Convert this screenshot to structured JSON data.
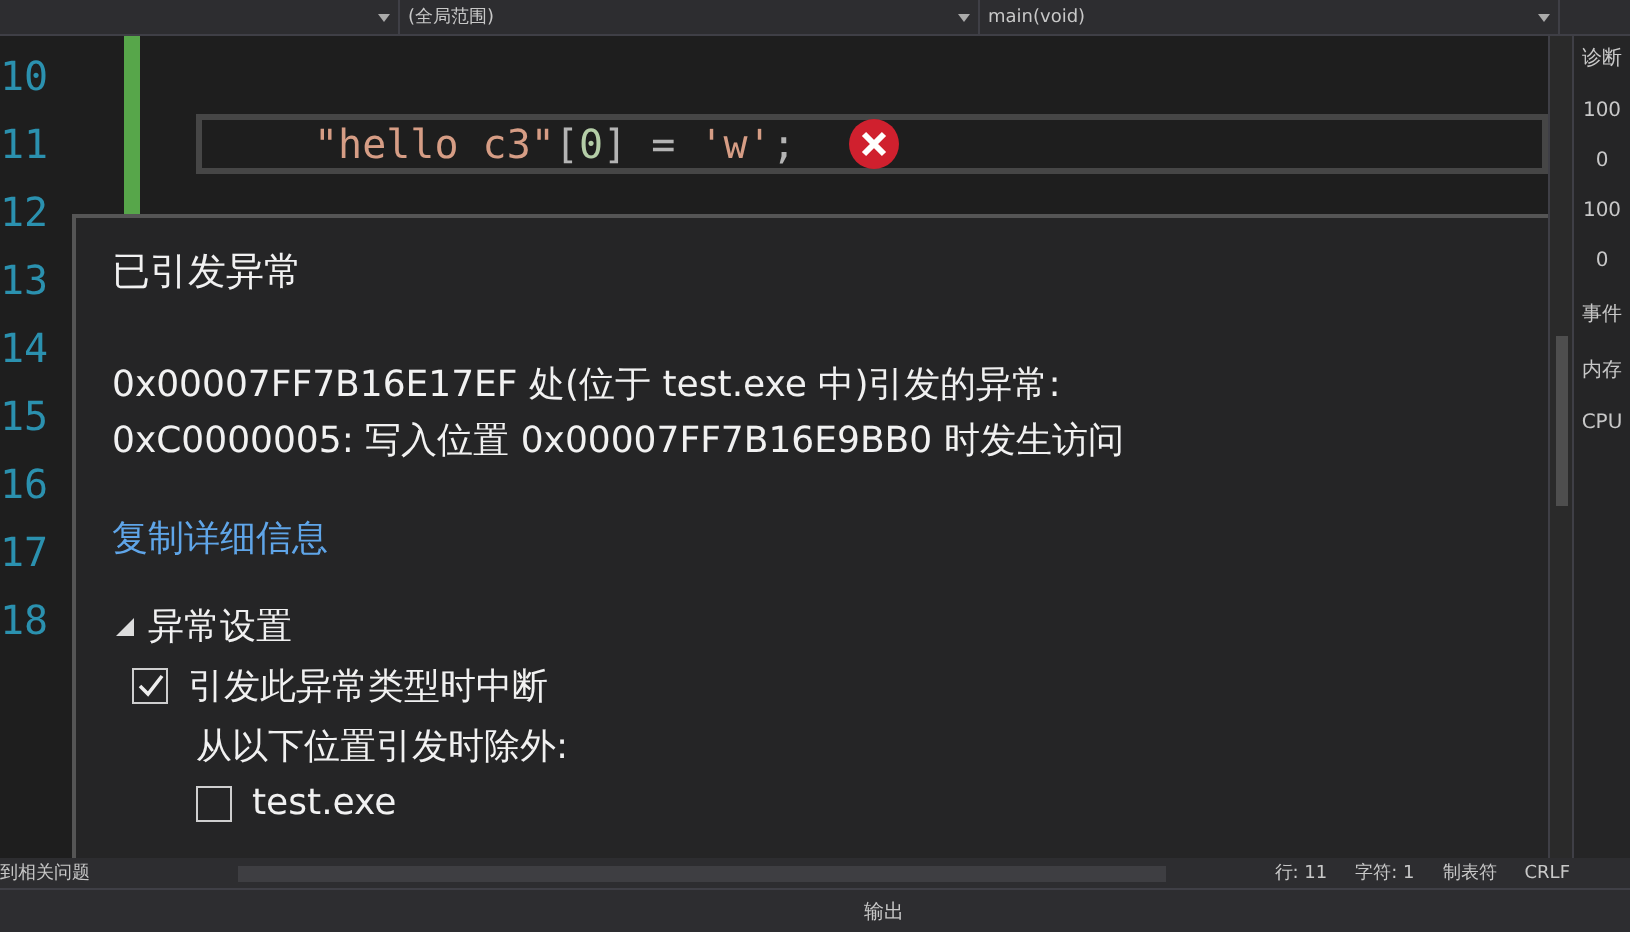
{
  "toolbar": {
    "dropdowns": [
      {
        "label": "(全局范围)"
      },
      {
        "label": "main(void)"
      }
    ]
  },
  "editor": {
    "lines": [
      {
        "number": "10",
        "current": false
      },
      {
        "number": "11",
        "current": true,
        "tokens": [
          {
            "kind": "string",
            "text": "\"hello c3\""
          },
          {
            "kind": "punct",
            "text": "["
          },
          {
            "kind": "number",
            "text": "0"
          },
          {
            "kind": "punct",
            "text": "] = "
          },
          {
            "kind": "string",
            "text": "'w'"
          },
          {
            "kind": "punct",
            "text": ";"
          }
        ]
      },
      {
        "number": "12",
        "current": false
      },
      {
        "number": "13",
        "current": false
      },
      {
        "number": "14",
        "current": false
      },
      {
        "number": "15",
        "current": false
      },
      {
        "number": "16",
        "current": false
      },
      {
        "number": "17",
        "current": false
      },
      {
        "number": "18",
        "current": false
      }
    ]
  },
  "exception": {
    "title": "已引发异常",
    "message": [
      "0x00007FF7B16E17EF 处(位于 test.exe 中)引发的异常:",
      "0xC0000005: 写入位置 0x00007FF7B16E9BB0 时发生访问"
    ],
    "link": "复制详细信息",
    "section": {
      "label": "异常设置",
      "expanded": true
    },
    "options": [
      {
        "kind": "checkbox",
        "label": "引发此异常类型时中断",
        "checked": true
      },
      {
        "kind": "text",
        "label": "从以下位置引发时除外:"
      },
      {
        "kind": "checkbox",
        "label": "test.exe",
        "checked": false
      }
    ]
  },
  "side_panel": {
    "title": "诊断",
    "texts": [
      "100",
      "0",
      "100",
      "0"
    ],
    "tabs": [
      "事件",
      "内存",
      "CPU"
    ]
  },
  "status_bar": {
    "left": "到相关问题",
    "items": [
      "行: 11",
      "字符: 1",
      "制表符",
      "CRLF"
    ]
  },
  "output_panel": {
    "title": "输出"
  }
}
